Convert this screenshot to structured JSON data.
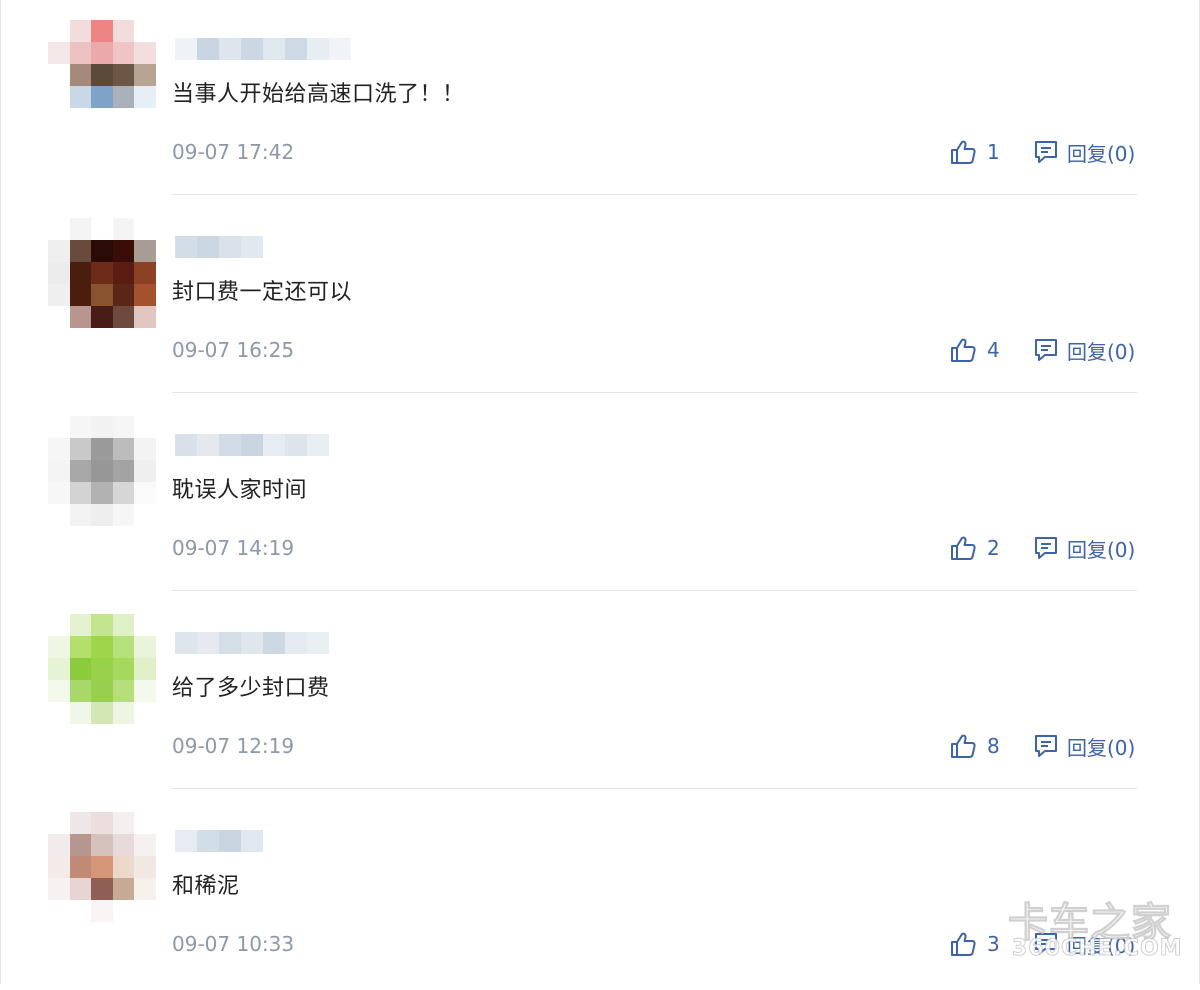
{
  "comments": [
    {
      "content": "当事人开始给高速口洗了！！",
      "time": "09-07 17:42",
      "likes": "1",
      "reply": "回复(0)",
      "avatar_colors": [
        "#ffffff",
        "#f3dcdc",
        "#ef8484",
        "#f3dcdc",
        "#ffffff",
        "#f4e7e7",
        "#eec2c3",
        "#eba9ab",
        "#efc4c4",
        "#f2dede",
        "#ffffff",
        "#a58a7b",
        "#5b4a3a",
        "#6c5645",
        "#b8a493",
        "#ffffff",
        "#c9d8e7",
        "#7ea3c9",
        "#a9b1ba",
        "#e6eef6",
        "#ffffff",
        "#ffffff",
        "#ffffff",
        "#ffffff",
        "#ffffff"
      ],
      "username_colors": [
        "#eef3f8",
        "#c9d6e2",
        "#dde6ef",
        "#cbd7e3",
        "#dfe7ef",
        "#cdd9e5",
        "#e6edf3",
        "#f0f4f8"
      ]
    },
    {
      "content": "封口费一定还可以",
      "time": "09-07 16:25",
      "likes": "4",
      "reply": "回复(0)",
      "avatar_colors": [
        "#ffffff",
        "#f4f4f4",
        "#ffffff",
        "#f4f4f4",
        "#ffffff",
        "#efefef",
        "#6b4a3e",
        "#2a0b05",
        "#3a0d08",
        "#a79d94",
        "#ececec",
        "#4a1e0e",
        "#6f2b1a",
        "#5b1d12",
        "#8a4124",
        "#efefef",
        "#4a1d0f",
        "#8a5330",
        "#5a2617",
        "#a3512e",
        "#ffffff",
        "#b9958f",
        "#4a1c17",
        "#6e4a3e",
        "#e0c5c0"
      ],
      "username_colors": [
        "#d3dde7",
        "#cbd7e3",
        "#d9e2eb",
        "#e1e8ef",
        "#ffffff"
      ]
    },
    {
      "content": "耽误人家时间",
      "time": "09-07 14:19",
      "likes": "2",
      "reply": "回复(0)",
      "avatar_colors": [
        "#ffffff",
        "#f6f6f6",
        "#f2f2f2",
        "#f5f5f5",
        "#ffffff",
        "#f5f5f5",
        "#c9c9c9",
        "#9a9a9a",
        "#bcbcbc",
        "#f3f3f3",
        "#f4f4f4",
        "#a8a8a8",
        "#979797",
        "#a3a3a3",
        "#efefef",
        "#f7f7f7",
        "#d2d2d2",
        "#b2b2b2",
        "#d6d6d6",
        "#fafafa",
        "#ffffff",
        "#f3f3f3",
        "#eeeeee",
        "#f6f6f6",
        "#ffffff"
      ],
      "username_colors": [
        "#d8e1ea",
        "#e3e9ef",
        "#d2dce6",
        "#c9d5e1",
        "#e6ecf2",
        "#dde5ec",
        "#e9eef3"
      ]
    },
    {
      "content": "给了多少封口费",
      "time": "09-07 12:19",
      "likes": "8",
      "reply": "回复(0)",
      "avatar_colors": [
        "#ffffff",
        "#e4f2cf",
        "#c2e58e",
        "#dff0c6",
        "#ffffff",
        "#eef7e3",
        "#b3df6a",
        "#9fd54a",
        "#b5e07a",
        "#e9f4db",
        "#e6f3d4",
        "#8ccc3c",
        "#98d24a",
        "#a5d85c",
        "#dff0c8",
        "#f2f8ea",
        "#a8d869",
        "#97cf4e",
        "#b6de7d",
        "#f3f9ec",
        "#ffffff",
        "#f0f6e8",
        "#d2e7b3",
        "#edf5e2",
        "#ffffff"
      ],
      "username_colors": [
        "#dde5ed",
        "#e4eaf0",
        "#d4dee7",
        "#dfe6ed",
        "#cdd8e3",
        "#e5ebf1",
        "#eaeff4"
      ]
    },
    {
      "content": "和稀泥",
      "time": "09-07 10:33",
      "likes": "3",
      "reply": "回复(0)",
      "avatar_colors": [
        "#ffffff",
        "#efe7e7",
        "#eddede",
        "#f4eeee",
        "#ffffff",
        "#f2ebeb",
        "#b6968f",
        "#d6c2bc",
        "#e7dada",
        "#f6f1f1",
        "#f3ebea",
        "#c08a76",
        "#d49677",
        "#ecd8cb",
        "#f1e8e4",
        "#f6f2f1",
        "#e6d5d2",
        "#8f5f56",
        "#c7aa96",
        "#f7f1ee",
        "#ffffff",
        "#ffffff",
        "#f8f4f3",
        "#ffffff",
        "#ffffff"
      ],
      "username_colors": [
        "#e6ecf2",
        "#d3dde7",
        "#c9d5e1",
        "#e0e7ee"
      ]
    }
  ],
  "icons": {
    "like": "thumbs-up-icon",
    "reply": "comment-icon"
  },
  "colors": {
    "action_blue": "#3d63a8",
    "timestamp_gray": "#8e98a7",
    "divider": "#e5e5e5"
  },
  "watermark": {
    "main": "卡车之家",
    "sub": "360CHE.COM"
  }
}
